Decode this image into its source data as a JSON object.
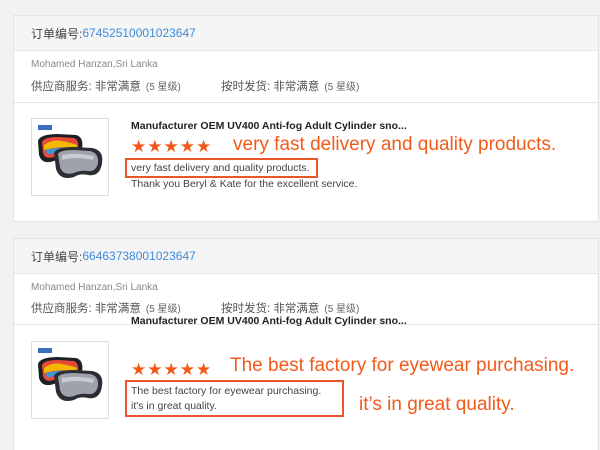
{
  "accent_color": "#f25a19",
  "link_color": "#3e8bd8",
  "orders": [
    {
      "order_label": "订单编号:",
      "order_no": "67452510001023647",
      "buyer": "Mohamed Hanzan,Sri Lanka",
      "supplier_service_label": "供应商服务: 非常满意",
      "supplier_service_grade": "(5 星级)",
      "on_time_label": "按时发货: 非常满意",
      "on_time_grade": "(5 星级)",
      "product_title": "Manufacturer OEM UV400 Anti-fog Adult Cylinder sno...",
      "stars": "★★★★★",
      "rating": 5,
      "review_lines": [
        "very fast delivery and quality products.",
        "Thank you Beryl & Kate for the excellent service."
      ],
      "annotations": [
        "very fast delivery and quality products."
      ]
    },
    {
      "order_label": "订单编号:",
      "order_no": "66463738001023647",
      "buyer": "Mohamed Hanzan,Sri Lanka",
      "supplier_service_label": "供应商服务: 非常满意",
      "supplier_service_grade": "(5 星级)",
      "on_time_label": "按时发货: 非常满意",
      "on_time_grade": "(5 星级)",
      "product_title": "Manufacturer OEM UV400 Anti-fog Adult Cylinder sno...",
      "stars": "★★★★★",
      "rating": 5,
      "review_lines": [
        "The best factory for eyewear purchasing.",
        "it's in great quality."
      ],
      "annotations": [
        "The best factory for eyewear purchasing.",
        "it’s in great quality."
      ]
    }
  ]
}
